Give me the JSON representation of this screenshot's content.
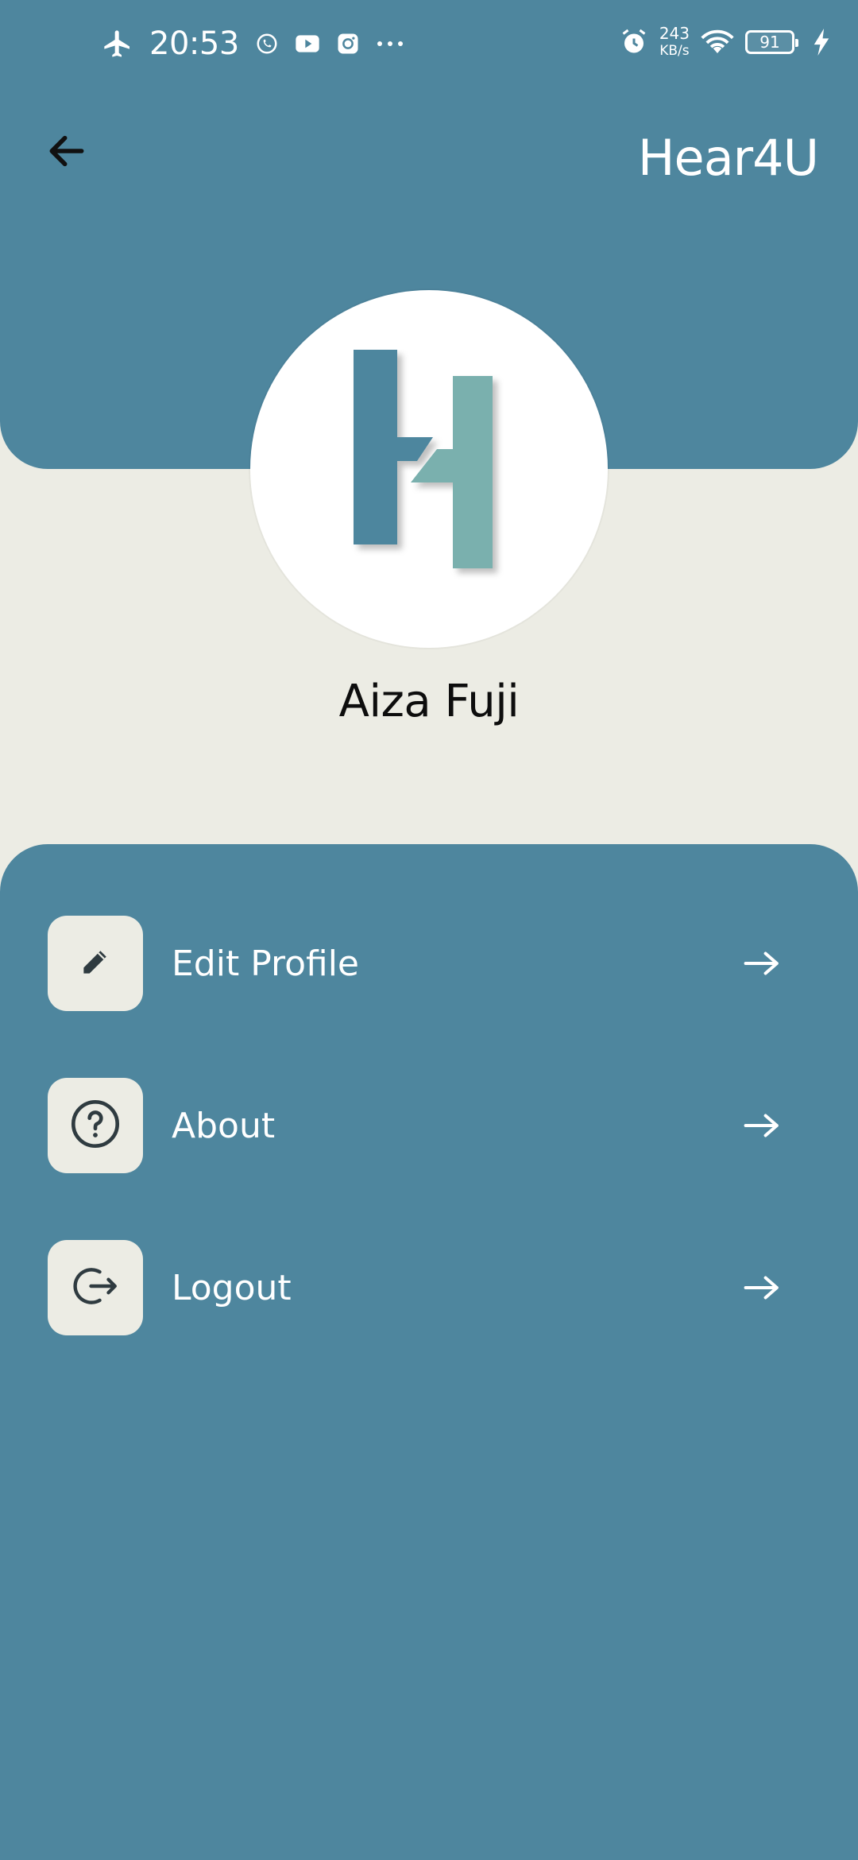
{
  "status_bar": {
    "time": "20:53",
    "net_speed_value": "243",
    "net_speed_unit": "KB/s",
    "battery_level": "91",
    "left_icons": [
      "airplane-icon",
      "whatsapp-icon",
      "youtube-icon",
      "instagram-icon",
      "more-dots-icon"
    ],
    "right_icons": [
      "alarm-icon",
      "wifi-icon",
      "battery-icon",
      "charging-bolt-icon"
    ]
  },
  "app_bar": {
    "title": "Hear4U",
    "back_icon": "arrow-left-icon"
  },
  "profile": {
    "name": "Aiza Fuji",
    "logo_letter": "H"
  },
  "menu": {
    "items": [
      {
        "label": "Edit Profile",
        "icon": "pencil-icon"
      },
      {
        "label": "About",
        "icon": "help-circle-icon"
      },
      {
        "label": "Logout",
        "icon": "logout-icon"
      }
    ]
  },
  "colors": {
    "primary": "#4E869E",
    "background": "#ECECE4",
    "logo_dark": "#4E869E",
    "logo_light": "#7AB0AE"
  }
}
